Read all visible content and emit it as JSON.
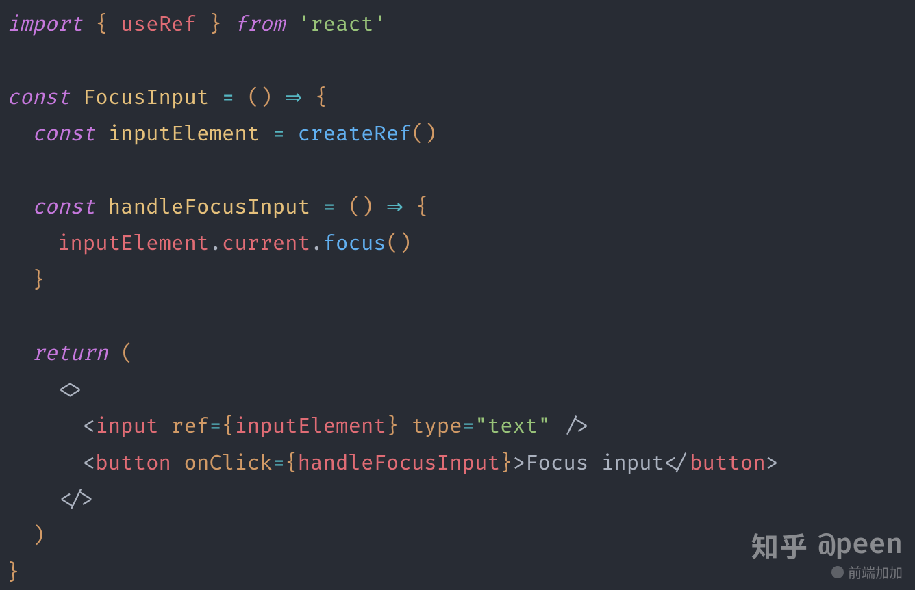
{
  "code": {
    "l1": {
      "import": "import",
      "lb": "{",
      "useRef": "useRef",
      "rb": "}",
      "from": "from",
      "react": "'react'"
    },
    "l3": {
      "const": "const",
      "FocusInput": "FocusInput",
      "eq": "=",
      "lp": "(",
      "rp": ")",
      "arrow": "⇒",
      "lb": "{"
    },
    "l4": {
      "const": "const",
      "inputElement": "inputElement",
      "eq": "=",
      "createRef": "createRef",
      "lp": "(",
      "rp": ")"
    },
    "l6": {
      "const": "const",
      "handleFocusInput": "handleFocusInput",
      "eq": "=",
      "lp": "(",
      "rp": ")",
      "arrow": "⇒",
      "lb": "{"
    },
    "l7": {
      "inputElement": "inputElement",
      "dot1": ".",
      "current": "current",
      "dot2": ".",
      "focus": "focus",
      "lp": "(",
      "rp": ")"
    },
    "l8": {
      "rb": "}"
    },
    "l10": {
      "return": "return",
      "lp": "("
    },
    "l11": {
      "frag_open": "<>"
    },
    "l12": {
      "lt": "<",
      "input": "input",
      "ref": "ref",
      "eq1": "=",
      "lb": "{",
      "inputElement": "inputElement",
      "rb": "}",
      "type": "type",
      "eq2": "=",
      "text": "\"text\"",
      "selfclose": "/>"
    },
    "l13": {
      "lt": "<",
      "button": "button",
      "onClick": "onClick",
      "eq": "=",
      "lb": "{",
      "handleFocusInput": "handleFocusInput",
      "rb": "}",
      "gt": ">",
      "label": "Focus input",
      "lt2": "</",
      "button2": "button",
      "gt2": ">"
    },
    "l14": {
      "frag_close": "</>"
    },
    "l15": {
      "rp": ")"
    },
    "l16": {
      "rb": "}"
    }
  },
  "watermark": {
    "site": "知乎",
    "handle": "@peen",
    "sub": "前端加加"
  }
}
